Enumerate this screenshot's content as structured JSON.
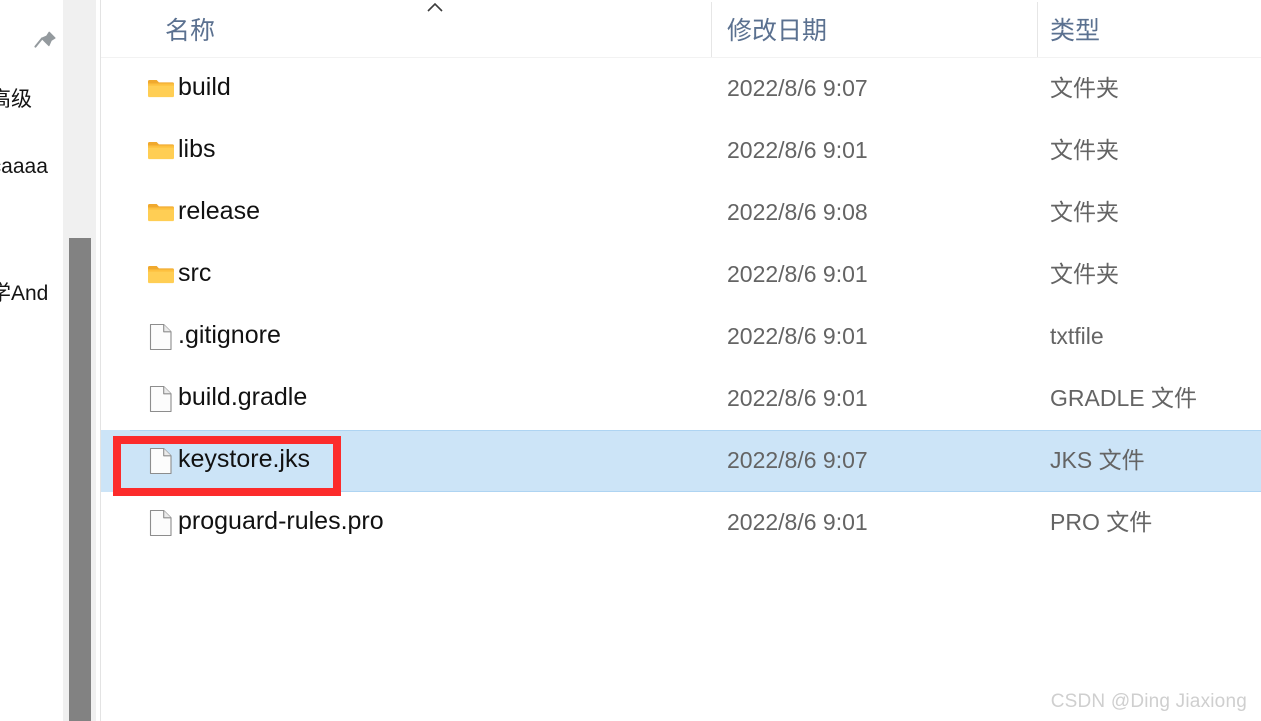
{
  "nav_pane": {
    "pin_icon": "pin-icon",
    "clipped_items": [
      {
        "label": "高级"
      },
      {
        "label": "icaaaa"
      },
      {
        "label": "学And"
      }
    ]
  },
  "scrollbar": {
    "orientation": "vertical",
    "thumb": "scrollbar-thumb"
  },
  "columns": {
    "name": "名称",
    "date_modified": "修改日期",
    "type": "类型",
    "sort_indicator": "chevron-up-icon",
    "sorted_by": "名称",
    "sort_direction": "ascending"
  },
  "colors": {
    "selection_fill": "#cce4f7",
    "selection_border": "#aed4f2",
    "annotation": "#fc2b2b",
    "header_text": "#5b7190",
    "folder": "#ffc843",
    "scrollbar_thumb": "#828282"
  },
  "rows": [
    {
      "icon": "folder-icon",
      "name": "build",
      "date": "2022/8/6 9:07",
      "type": "文件夹",
      "selected": false
    },
    {
      "icon": "folder-icon",
      "name": "libs",
      "date": "2022/8/6 9:01",
      "type": "文件夹",
      "selected": false
    },
    {
      "icon": "folder-icon",
      "name": "release",
      "date": "2022/8/6 9:08",
      "type": "文件夹",
      "selected": false
    },
    {
      "icon": "folder-icon",
      "name": "src",
      "date": "2022/8/6 9:01",
      "type": "文件夹",
      "selected": false
    },
    {
      "icon": "file-icon",
      "name": ".gitignore",
      "date": "2022/8/6 9:01",
      "type": "txtfile",
      "selected": false
    },
    {
      "icon": "file-icon",
      "name": "build.gradle",
      "date": "2022/8/6 9:01",
      "type": "GRADLE 文件",
      "selected": false
    },
    {
      "icon": "file-icon",
      "name": "keystore.jks",
      "date": "2022/8/6 9:07",
      "type": "JKS 文件",
      "selected": true
    },
    {
      "icon": "file-icon",
      "name": "proguard-rules.pro",
      "date": "2022/8/6 9:01",
      "type": "PRO 文件",
      "selected": false
    }
  ],
  "annotation": {
    "shape": "rectangle",
    "targets": "keystore.jks"
  },
  "watermark": {
    "text": "CSDN @Ding Jiaxiong"
  }
}
